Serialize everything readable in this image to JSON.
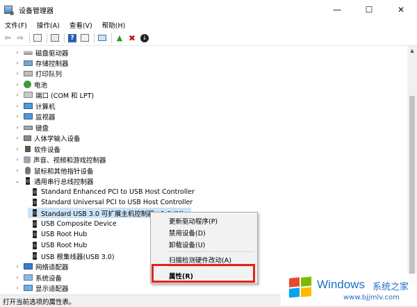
{
  "window": {
    "title": "设备管理器",
    "controls": {
      "minimize": "—",
      "maximize": "☐",
      "close": "✕"
    }
  },
  "menubar": {
    "items": [
      "文件(F)",
      "操作(A)",
      "查看(V)",
      "帮助(H)"
    ]
  },
  "toolbar": {
    "icons": [
      "back-icon",
      "forward-icon",
      "device-view-icon",
      "properties-icon",
      "help-icon",
      "properties-pane-icon",
      "scan-monitor-icon",
      "update-driver-icon",
      "uninstall-icon",
      "download-icon"
    ],
    "glyphs": {
      "back": "⇦",
      "forward": "⇨",
      "help": "?",
      "update": "▲",
      "uninstall": "✖",
      "download": "↓"
    }
  },
  "tree": {
    "rows": [
      {
        "label": "磁盘驱动器",
        "icon": "disk-drive-icon",
        "expand": "collapsed"
      },
      {
        "label": "存储控制器",
        "icon": "storage-controller-icon",
        "expand": "collapsed"
      },
      {
        "label": "打印队列",
        "icon": "printer-icon",
        "expand": "collapsed"
      },
      {
        "label": "电池",
        "icon": "battery-icon",
        "expand": "collapsed"
      },
      {
        "label": "端口 (COM 和 LPT)",
        "icon": "port-icon",
        "expand": "collapsed"
      },
      {
        "label": "计算机",
        "icon": "computer-icon",
        "expand": "collapsed"
      },
      {
        "label": "监视器",
        "icon": "monitor-icon",
        "expand": "collapsed"
      },
      {
        "label": "键盘",
        "icon": "keyboard-icon",
        "expand": "collapsed"
      },
      {
        "label": "人体学输入设备",
        "icon": "hid-icon",
        "expand": "collapsed"
      },
      {
        "label": "软件设备",
        "icon": "software-device-icon",
        "expand": "collapsed"
      },
      {
        "label": "声音、视频和游戏控制器",
        "icon": "sound-icon",
        "expand": "collapsed"
      },
      {
        "label": "鼠标和其他指针设备",
        "icon": "mouse-icon",
        "expand": "collapsed"
      },
      {
        "label": "通用串行总线控制器",
        "icon": "usb-category-icon",
        "expand": "expanded"
      },
      {
        "label": "Standard Enhanced PCI to USB Host Controller",
        "icon": "usb-icon",
        "child": true
      },
      {
        "label": "Standard Universal PCI to USB Host Controller",
        "icon": "usb-icon",
        "child": true
      },
      {
        "label": "Standard USB 3.0 可扩展主机控制器 - 1.0 (Mi...",
        "icon": "usb-icon",
        "child": true,
        "selected": true
      },
      {
        "label": "USB Composite Device",
        "icon": "usb-icon",
        "child": true
      },
      {
        "label": "USB Root Hub",
        "icon": "usb-icon",
        "child": true
      },
      {
        "label": "USB Root Hub",
        "icon": "usb-icon",
        "child": true
      },
      {
        "label": "USB 根集线器(USB 3.0)",
        "icon": "usb-icon",
        "child": true
      },
      {
        "label": "网络适配器",
        "icon": "network-icon",
        "expand": "collapsed"
      },
      {
        "label": "系统设备",
        "icon": "system-icon",
        "expand": "collapsed"
      },
      {
        "label": "显示适配器",
        "icon": "display-icon",
        "expand": "collapsed"
      }
    ],
    "chevrons": {
      "collapsed": "›",
      "expanded": "⌄"
    }
  },
  "context_menu": {
    "items": [
      {
        "label": "更新驱动程序(P)"
      },
      {
        "label": "禁用设备(D)"
      },
      {
        "label": "卸载设备(U)"
      },
      {
        "label": "扫描检测硬件改动(A)"
      },
      {
        "label": "属性(R)",
        "bold": true,
        "highlighted": true
      }
    ],
    "highlight_color": "#e2231a"
  },
  "statusbar": {
    "text": "打开当前选项的属性表。"
  },
  "watermark": {
    "brand": "Windows",
    "site": "系统之家",
    "url": "www.bjjmlv.com",
    "brand_color": "#1f6fc5",
    "logo_colors": [
      "#e84a2a",
      "#7cbb00",
      "#00a4ef",
      "#ffb900"
    ]
  },
  "scrollbar": {
    "up_glyph": "▲"
  }
}
